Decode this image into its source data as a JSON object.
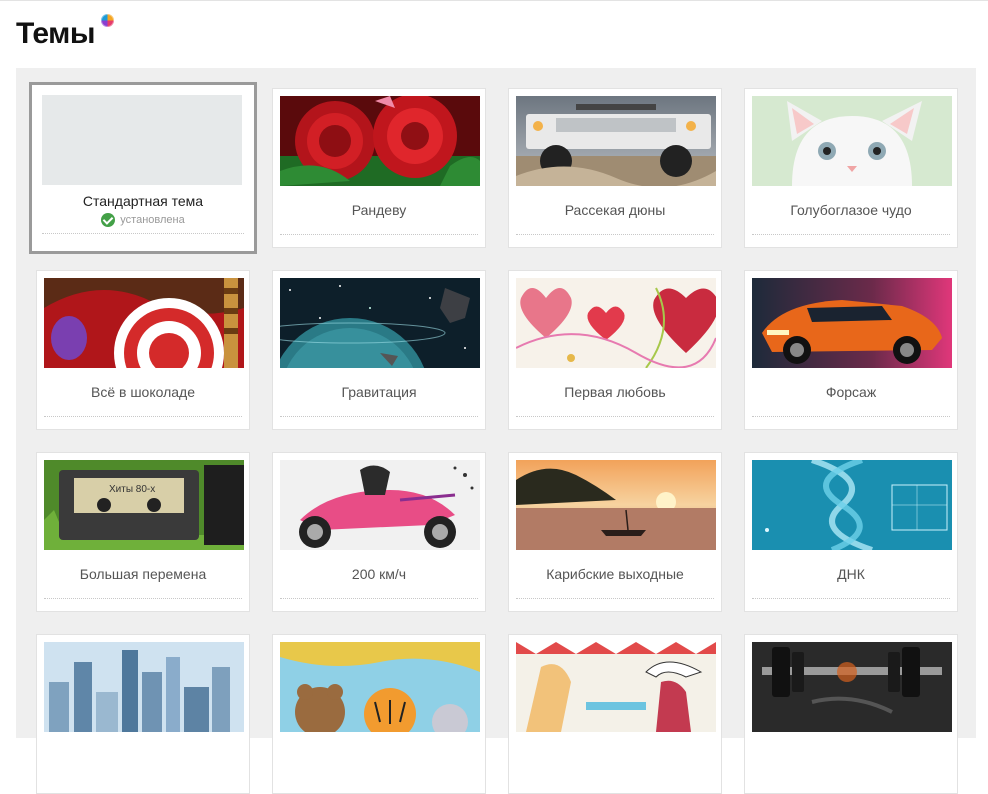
{
  "page": {
    "title": "Темы"
  },
  "colors": {
    "panel_bg": "#efefef",
    "selected_border": "#9a9a9a",
    "installed_check": "#43a047"
  },
  "themes": [
    {
      "label": "Стандартная тема",
      "status": "установлена",
      "selected": true,
      "icon": "blank-thumbnail"
    },
    {
      "label": "Рандеву",
      "icon": "red-roses-thumbnail"
    },
    {
      "label": "Рассекая дюны",
      "icon": "offroad-truck-thumbnail"
    },
    {
      "label": "Голубоглазое чудо",
      "icon": "white-kitten-thumbnail"
    },
    {
      "label": "Всё в шоколаде",
      "icon": "candy-chocolate-thumbnail"
    },
    {
      "label": "Гравитация",
      "icon": "space-planet-thumbnail"
    },
    {
      "label": "Первая любовь",
      "icon": "hearts-thumbnail"
    },
    {
      "label": "Форсаж",
      "icon": "orange-sportscar-thumbnail"
    },
    {
      "label": "Большая перемена",
      "icon": "cassette-tape-thumbnail"
    },
    {
      "label": "200 км/ч",
      "icon": "motorbike-thumbnail"
    },
    {
      "label": "Карибские выходные",
      "icon": "sunset-boat-thumbnail"
    },
    {
      "label": "ДНК",
      "icon": "dna-helix-thumbnail"
    },
    {
      "label": "",
      "icon": "city-skyline-thumbnail"
    },
    {
      "label": "",
      "icon": "cartoon-animals-thumbnail"
    },
    {
      "label": "",
      "icon": "beach-cafe-thumbnail"
    },
    {
      "label": "",
      "icon": "dumbbell-thumbnail"
    }
  ],
  "thumb_text": {
    "cassette": "Хиты 80-х"
  }
}
